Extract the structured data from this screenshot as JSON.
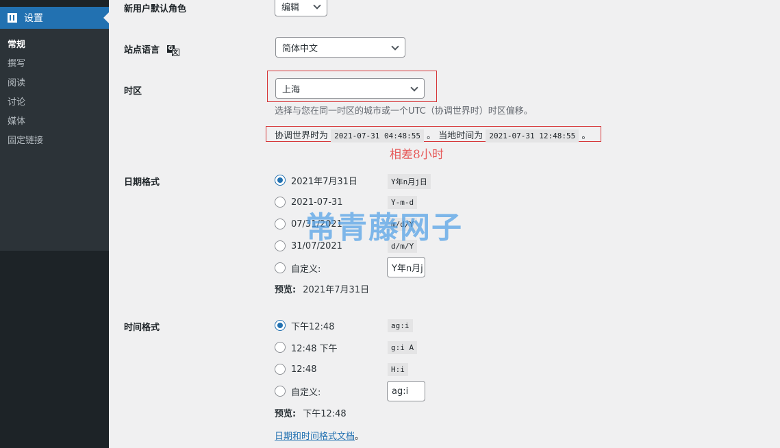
{
  "sidebar": {
    "active_label": "设置",
    "items": [
      {
        "label": "常规",
        "current": true
      },
      {
        "label": "撰写"
      },
      {
        "label": "阅读"
      },
      {
        "label": "讨论"
      },
      {
        "label": "媒体"
      },
      {
        "label": "固定链接"
      }
    ]
  },
  "default_role": {
    "label": "新用户默认角色",
    "value": "编辑"
  },
  "site_language": {
    "label": "站点语言",
    "value": "简体中文"
  },
  "timezone": {
    "label": "时区",
    "value": "上海",
    "description": "选择与您在同一时区的城市或一个UTC（协调世界时）时区偏移。",
    "utc_prefix": "协调世界时为",
    "utc_time": "2021-07-31 04:48:55",
    "local_prefix": "。 当地时间为",
    "local_time": "2021-07-31 12:48:55",
    "suffix": "。",
    "annotation": "相差8小时"
  },
  "date_format": {
    "label": "日期格式",
    "options": [
      {
        "text": "2021年7月31日",
        "code": "Y年n月j日",
        "checked": true
      },
      {
        "text": "2021-07-31",
        "code": "Y-m-d"
      },
      {
        "text": "07/31/2021",
        "code": "m/d/Y"
      },
      {
        "text": "31/07/2021",
        "code": "d/m/Y"
      }
    ],
    "custom_label": "自定义:",
    "custom_value": "Y年n月j日",
    "preview_label": "预览:",
    "preview_value": "2021年7月31日"
  },
  "time_format": {
    "label": "时间格式",
    "options": [
      {
        "text": "下午12:48",
        "code": "ag:i",
        "checked": true
      },
      {
        "text": "12:48 下午",
        "code": "g:i A"
      },
      {
        "text": "12:48",
        "code": "H:i"
      }
    ],
    "custom_label": "自定义:",
    "custom_value": "ag:i",
    "preview_label": "预览:",
    "preview_value": "下午12:48"
  },
  "doc_link": {
    "text": "日期和时间格式文档",
    "suffix": "。"
  },
  "watermark": "常青藤网子",
  "colors": {
    "accent": "#2271b1",
    "highlight": "#d63638",
    "sidebar": "#1d2327"
  }
}
